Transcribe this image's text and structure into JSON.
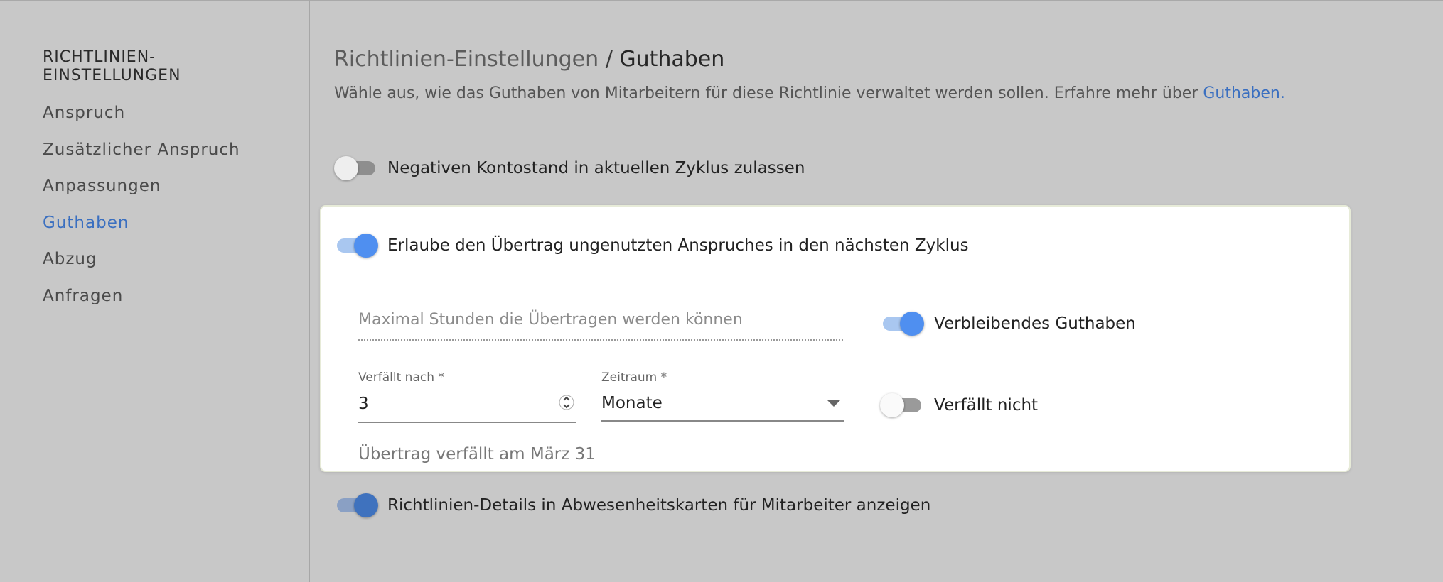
{
  "sidebar": {
    "title": "RICHTLINIEN-\nEINSTELLUNGEN",
    "items": [
      {
        "label": "Anspruch",
        "active": false
      },
      {
        "label": "Zusätzlicher Anspruch",
        "active": false
      },
      {
        "label": "Anpassungen",
        "active": false
      },
      {
        "label": "Guthaben",
        "active": true
      },
      {
        "label": "Abzug",
        "active": false
      },
      {
        "label": "Anfragen",
        "active": false
      }
    ]
  },
  "header": {
    "breadcrumb_parent": "Richtlinien-Einstellungen",
    "breadcrumb_separator": "/",
    "breadcrumb_current": "Guthaben",
    "description": "Wähle aus, wie das Guthaben von Mitarbeitern für diese Richtlinie verwaltet werden sollen. Erfahre mehr über ",
    "description_link": "Guthaben."
  },
  "settings": {
    "negative_balance": {
      "label": "Negativen Kontostand in aktuellen Zyklus zulassen",
      "enabled": false
    },
    "carryover": {
      "label": "Erlaube den Übertrag ungenutzten Anspruches in den nächsten Zyklus",
      "enabled": true
    },
    "max_hours": {
      "placeholder": "Maximal Stunden die Übertragen werden können",
      "value": ""
    },
    "remaining_balance": {
      "label": "Verbleibendes Guthaben",
      "enabled": true
    },
    "expires_after": {
      "label": "Verfällt nach *",
      "value": "3"
    },
    "period": {
      "label": "Zeitraum *",
      "value": "Monate"
    },
    "never_expires": {
      "label": "Verfällt nicht",
      "enabled": false
    },
    "expiry_hint": "Übertrag verfällt am März 31",
    "show_details": {
      "label": "Richtlinien-Details in Abwesenheitskarten für Mitarbeiter anzeigen",
      "enabled": true
    }
  },
  "colors": {
    "accent": "#3a6fc0",
    "toggle_on": "#4f8ff0",
    "background": "#c8c8c8"
  }
}
